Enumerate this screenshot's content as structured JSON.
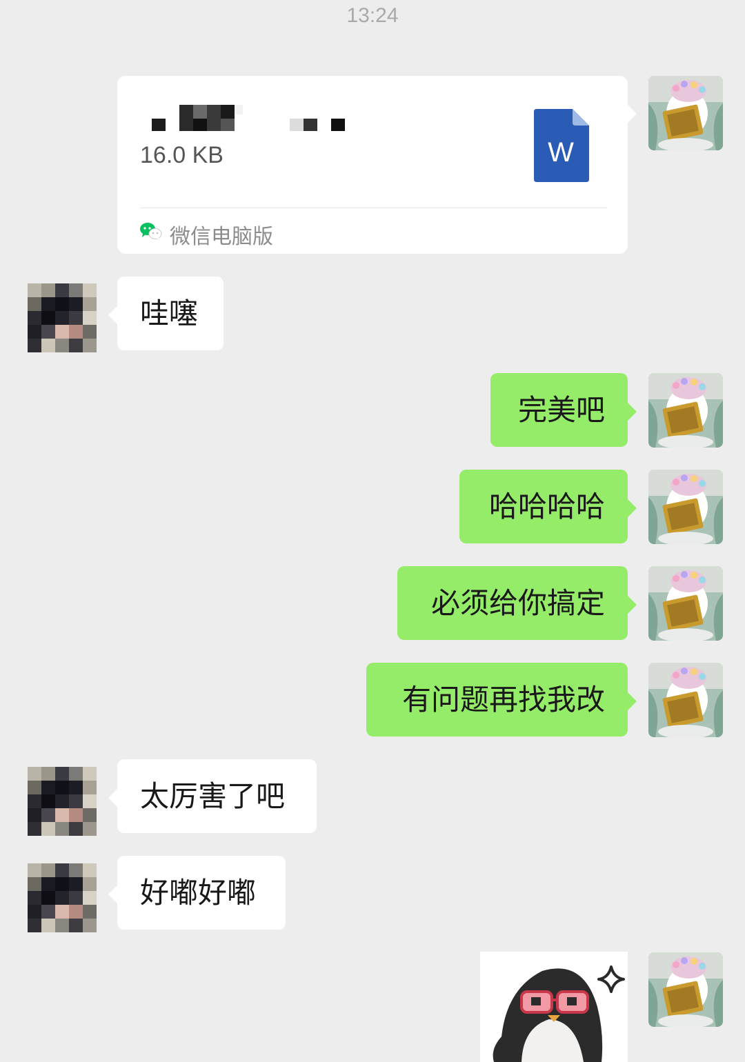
{
  "timestamp": "13:24",
  "file_message": {
    "size": "16.0 KB",
    "file_type_icon": "word-document-icon",
    "file_type_letter": "W",
    "source": "微信电脑版",
    "source_icon": "wechat-icon"
  },
  "messages": [
    {
      "side": "in",
      "text": "哇噻"
    },
    {
      "side": "out",
      "text": "完美吧"
    },
    {
      "side": "out",
      "text": "哈哈哈哈"
    },
    {
      "side": "out",
      "text": "必须给你搞定"
    },
    {
      "side": "out",
      "text": "有问题再找我改"
    },
    {
      "side": "in",
      "text": "太厉害了吧"
    },
    {
      "side": "in",
      "text": "好嘟好嘟"
    }
  ],
  "sticker": {
    "description_icon": "penguin-sticker"
  },
  "colors": {
    "background": "#ededed",
    "incoming_bubble": "#ffffff",
    "outgoing_bubble": "#95ec69",
    "word_blue": "#2b5cb5",
    "wechat_green": "#07c160"
  }
}
